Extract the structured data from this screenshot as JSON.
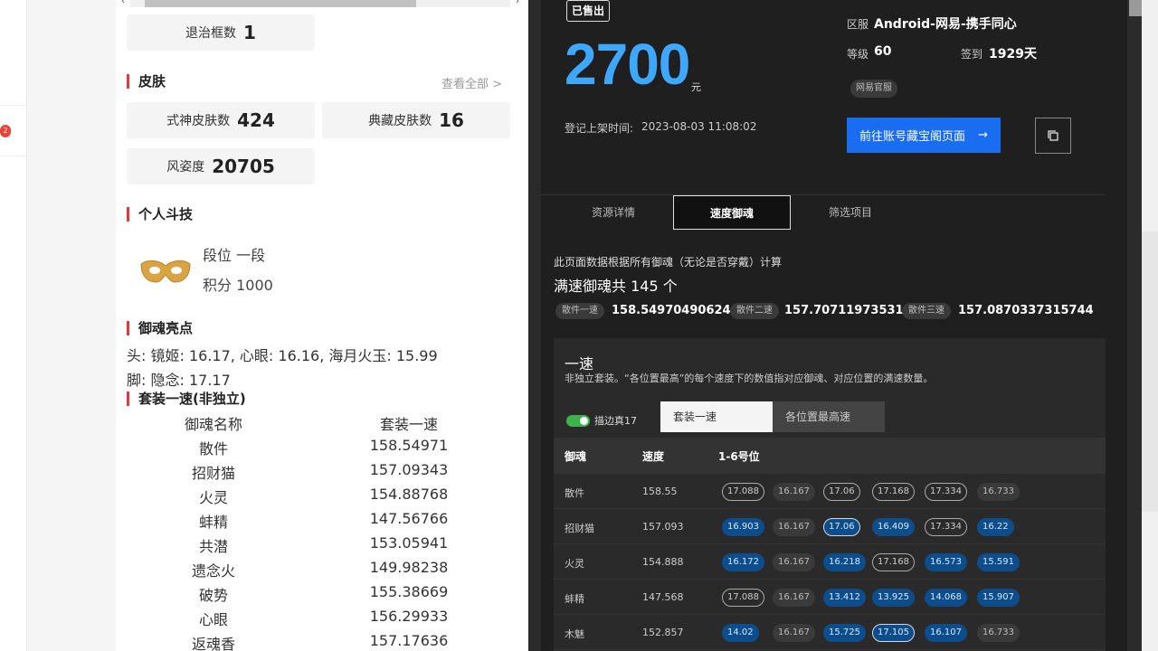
{
  "left": {
    "exit_frames": {
      "label": "退治框数",
      "value": "1"
    },
    "skins": {
      "title": "皮肤",
      "view_all": "查看全部 >",
      "shikigami_skins": {
        "label": "式神皮肤数",
        "value": "424"
      },
      "collection_skins": {
        "label": "典藏皮肤数",
        "value": "16"
      },
      "style": {
        "label": "风姿度",
        "value": "20705"
      }
    },
    "pvp": {
      "title": "个人斗技",
      "rank": "段位 一段",
      "points": "积分 1000"
    },
    "soul_highlights": {
      "title": "御魂亮点",
      "head": "头: 镜姬: 16.17, 心眼: 16.16, 海月火玉: 15.99",
      "foot": "脚: 隐念: 17.17"
    },
    "set_speed": {
      "title": "套装一速(非独立)",
      "headers": [
        "御魂名称",
        "套装一速"
      ],
      "rows": [
        [
          "散件",
          "158.54971"
        ],
        [
          "招财猫",
          "157.09343"
        ],
        [
          "火灵",
          "154.88768"
        ],
        [
          "蚌精",
          "147.56766"
        ],
        [
          "共潜",
          "153.05941"
        ],
        [
          "遗念火",
          "149.98238"
        ],
        [
          "破势",
          "155.38669"
        ],
        [
          "心眼",
          "156.29933"
        ],
        [
          "返魂香",
          "157.17636"
        ]
      ]
    }
  },
  "right": {
    "sold_badge": "已售出",
    "price": "2700",
    "price_unit": "元",
    "listing_time_label": "登记上架时间:",
    "listing_time_value": "2023-08-03 11:08:02",
    "server_label": "区服",
    "server_value": "Android-网易-携手同心",
    "level_label": "等级",
    "level_value": "60",
    "checkin_label": "签到",
    "checkin_value": "1929天",
    "tag": "网易官服",
    "cta": "前往账号藏宝阁页面",
    "cta_arrow": "→",
    "tabs": [
      "资源详情",
      "速度御魂",
      "筛选项目"
    ],
    "note": "此页面数据根据所有御魂（无论是否穿戴）计算",
    "full_speed": "满速御魂共 145 个",
    "speeds": [
      {
        "tag": "散件一速",
        "value": "158.54970490624655"
      },
      {
        "tag": "散件二速",
        "value": "157.70711973531607"
      },
      {
        "tag": "散件三速",
        "value": "157.0870337315744"
      }
    ],
    "card": {
      "title": "一速",
      "desc": "非独立套装。“各位置最高”的每个速度下的数值指对应御魂、对应位置的满速数量。",
      "toggle_label": "描边真17",
      "seg_active": "套装一速",
      "seg_inactive": "各位置最高速",
      "headers": [
        "御魂",
        "速度",
        "1-6号位"
      ],
      "rows": [
        {
          "name": "散件",
          "speed": "158.55",
          "cells": [
            [
              "17.088",
              "hl"
            ],
            [
              "16.167",
              "gray"
            ],
            [
              "17.06",
              "hl"
            ],
            [
              "17.168",
              "hl"
            ],
            [
              "17.334",
              "hl"
            ],
            [
              "16.733",
              "gray"
            ]
          ]
        },
        {
          "name": "招财猫",
          "speed": "157.093",
          "cells": [
            [
              "16.903",
              "blue"
            ],
            [
              "16.167",
              "gray"
            ],
            [
              "17.06",
              "bluehl"
            ],
            [
              "16.409",
              "blue"
            ],
            [
              "17.334",
              "hl"
            ],
            [
              "16.22",
              "blue"
            ]
          ]
        },
        {
          "name": "火灵",
          "speed": "154.888",
          "cells": [
            [
              "16.172",
              "blue"
            ],
            [
              "16.167",
              "gray"
            ],
            [
              "16.218",
              "blue"
            ],
            [
              "17.168",
              "hl"
            ],
            [
              "16.573",
              "blue"
            ],
            [
              "15.591",
              "blue"
            ]
          ]
        },
        {
          "name": "蚌精",
          "speed": "147.568",
          "cells": [
            [
              "17.088",
              "hl"
            ],
            [
              "16.167",
              "gray"
            ],
            [
              "13.412",
              "blue"
            ],
            [
              "13.925",
              "blue"
            ],
            [
              "14.068",
              "blue"
            ],
            [
              "15.907",
              "blue"
            ]
          ]
        },
        {
          "name": "木魅",
          "speed": "152.857",
          "cells": [
            [
              "14.02",
              "blue"
            ],
            [
              "16.167",
              "gray"
            ],
            [
              "15.725",
              "blue"
            ],
            [
              "17.105",
              "bluehl"
            ],
            [
              "16.107",
              "blue"
            ],
            [
              "16.733",
              "gray"
            ]
          ]
        }
      ]
    }
  }
}
